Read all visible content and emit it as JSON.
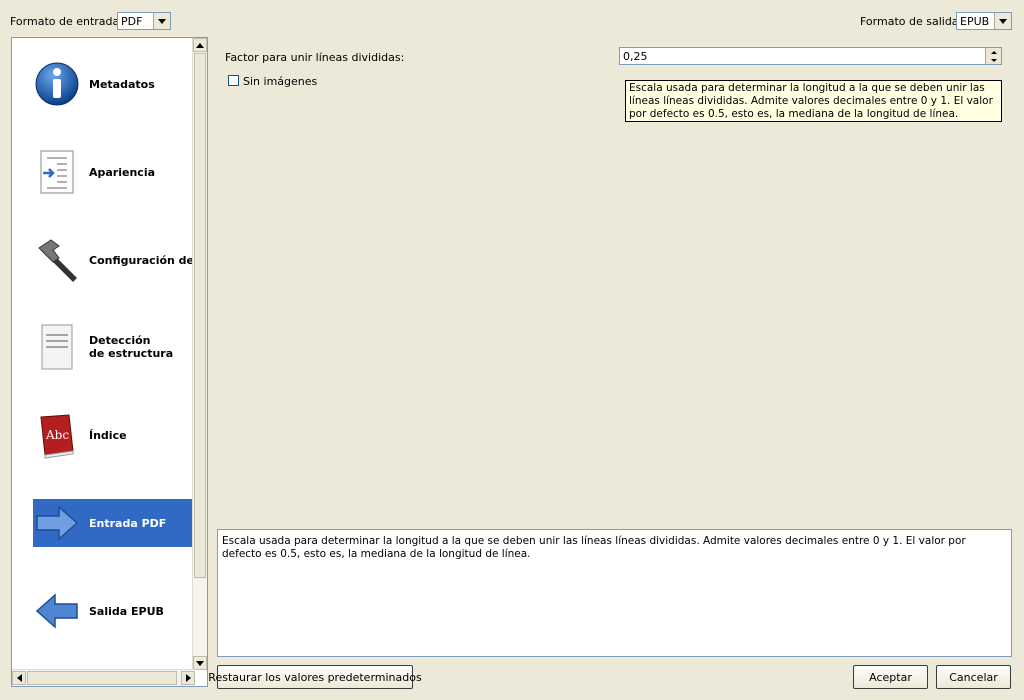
{
  "top": {
    "input_format_label": "Formato de entrada:",
    "input_format_value": "PDF",
    "output_format_label": "Formato de salida:",
    "output_format_value": "EPUB"
  },
  "sidebar": {
    "items": [
      {
        "label": "Metadatos",
        "icon": "info-icon"
      },
      {
        "label": "Apariencia",
        "icon": "document-indent-icon"
      },
      {
        "label": "Configuración de p",
        "icon": "hammer-icon"
      },
      {
        "label_line1": "Detección",
        "label_line2": "de estructura",
        "icon": "document-lines-icon"
      },
      {
        "label": "Índice",
        "icon": "book-abc-icon"
      },
      {
        "label": "Entrada PDF",
        "icon": "arrow-right-icon",
        "selected": true
      },
      {
        "label": "Salida EPUB",
        "icon": "arrow-left-icon"
      }
    ]
  },
  "options": {
    "line_unwrap_label": "Factor para unir líneas divididas:",
    "line_unwrap_value": "0,25",
    "no_images_label": "Sin imágenes",
    "no_images_checked": false
  },
  "tooltip": {
    "text": "Escala usada para determinar la longitud a la que se deben unir las líneas líneas divididas. Admite valores decimales entre 0 y 1. El valor por defecto es 0.5, esto es, la mediana de la longitud de línea."
  },
  "description": {
    "text": "Escala usada para determinar la longitud a la que se deben unir las líneas líneas divididas. Admite valores decimales entre 0 y 1. El valor por defecto es 0.5, esto es, la mediana de la longitud de línea."
  },
  "buttons": {
    "restore": "Restaurar los valores predeterminados",
    "ok": "Aceptar",
    "cancel": "Cancelar"
  },
  "colors": {
    "background": "#ece9d8",
    "selection": "#316ac5",
    "tooltip_bg": "#ffffe1"
  }
}
